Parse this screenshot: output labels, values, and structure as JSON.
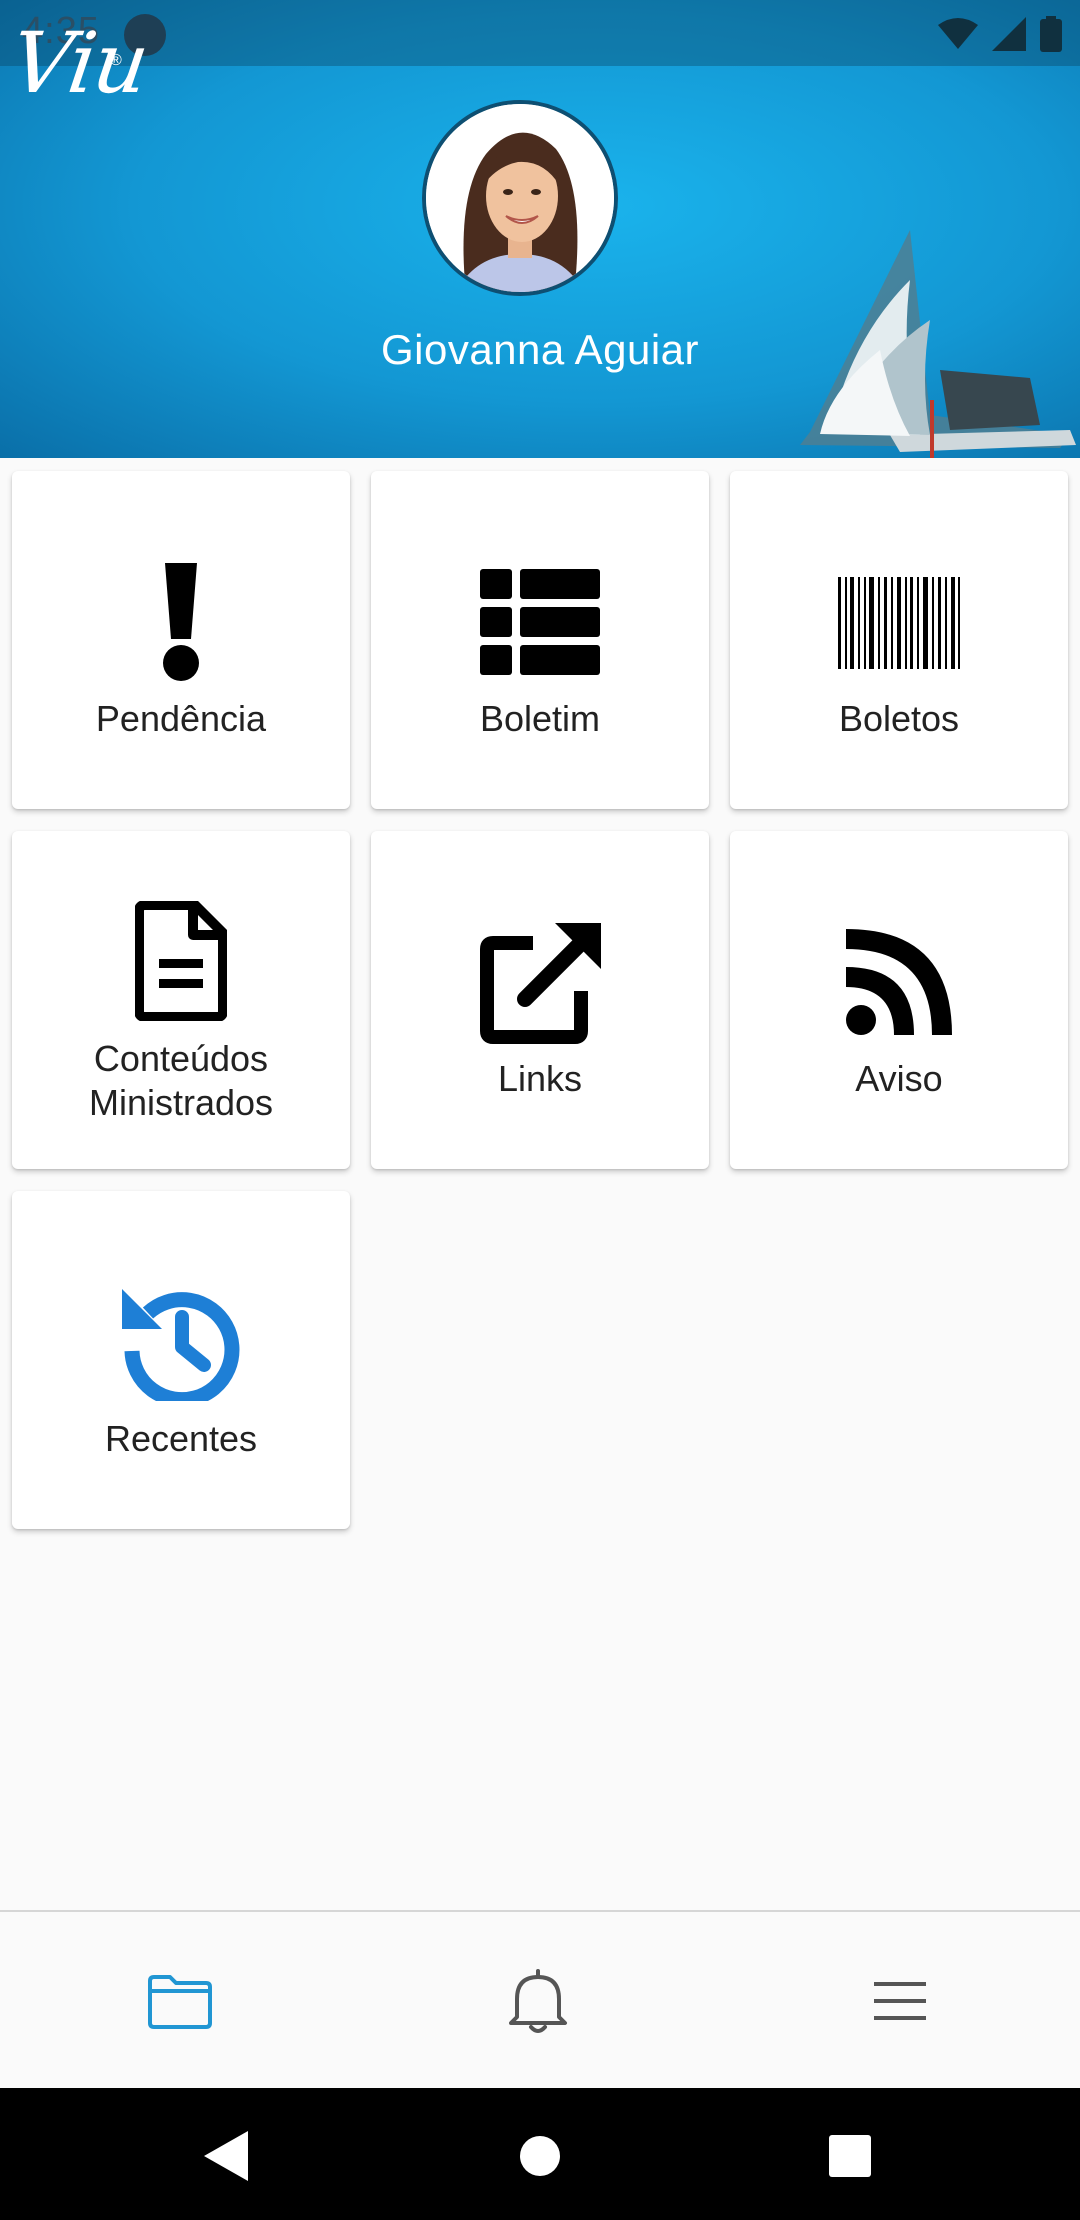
{
  "status_bar": {
    "time": "4:35"
  },
  "header": {
    "logo": "Viu",
    "logo_mark": "®",
    "user_name": "Giovanna Aguiar"
  },
  "tiles": [
    {
      "label": "Pendência",
      "icon": "exclamation-icon"
    },
    {
      "label": "Boletim",
      "icon": "list-grid-icon"
    },
    {
      "label": "Boletos",
      "icon": "barcode-icon"
    },
    {
      "label": "Conteúdos\nMinistrados",
      "icon": "document-icon"
    },
    {
      "label": "Links",
      "icon": "external-link-icon"
    },
    {
      "label": "Aviso",
      "icon": "rss-icon"
    },
    {
      "label": "Recentes",
      "icon": "history-icon"
    }
  ],
  "bottom_nav": [
    {
      "name": "folder",
      "icon": "folder-icon",
      "active": true
    },
    {
      "name": "notifications",
      "icon": "bell-icon",
      "active": false
    },
    {
      "name": "menu",
      "icon": "hamburger-menu-icon",
      "active": false
    }
  ],
  "colors": {
    "header_blue": "#1397d3",
    "accent_blue": "#1e7fd6",
    "nav_active": "#2196d3",
    "nav_inactive": "#555555"
  }
}
